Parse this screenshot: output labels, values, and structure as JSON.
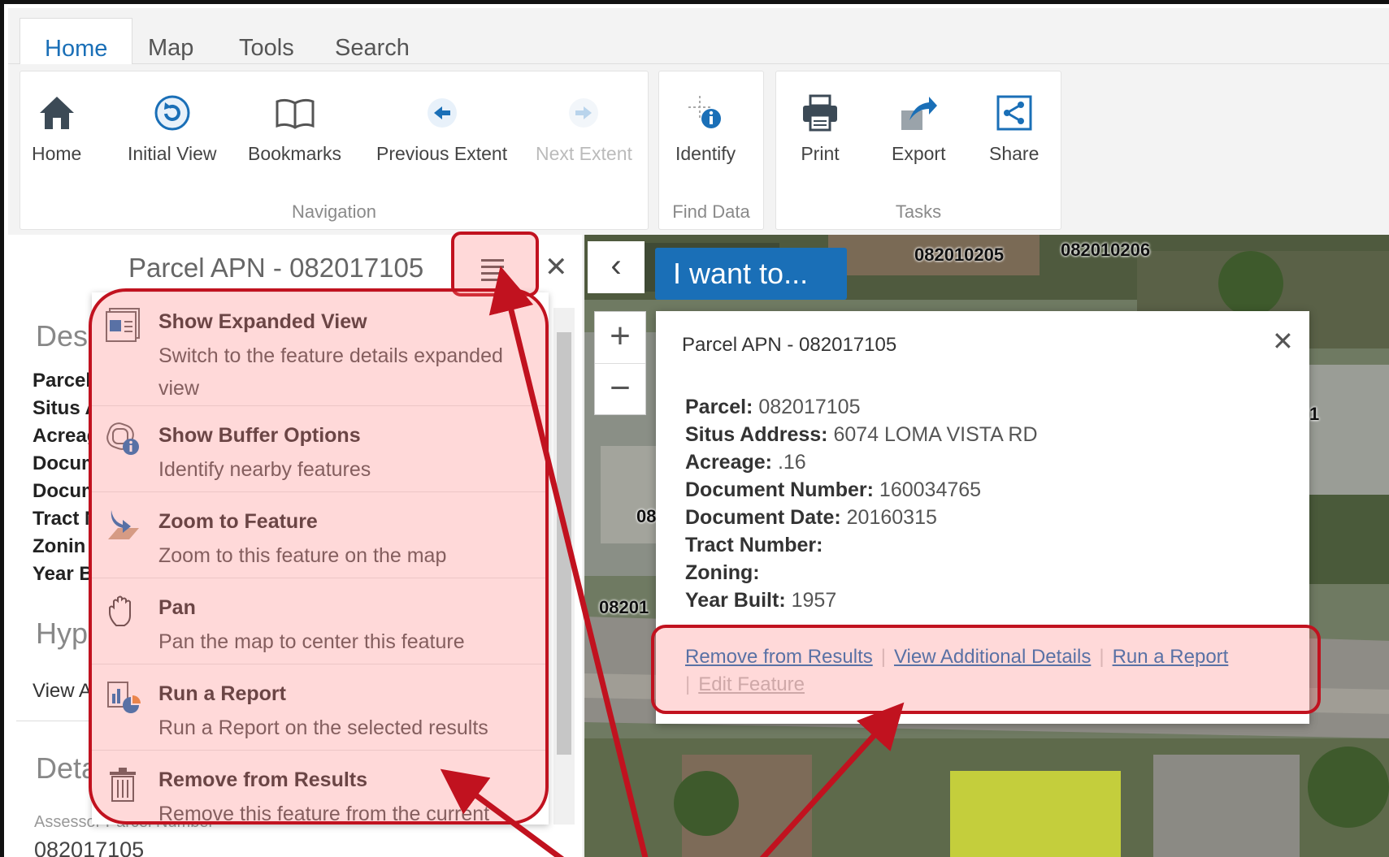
{
  "tabs": [
    "Home",
    "Map",
    "Tools",
    "Search"
  ],
  "navigation": {
    "group_label": "Navigation",
    "tools": [
      "Home",
      "Initial View",
      "Bookmarks",
      "Previous Extent",
      "Next Extent"
    ]
  },
  "find_data": {
    "group_label": "Find Data",
    "tools": [
      "Identify"
    ]
  },
  "tasks": {
    "group_label": "Tasks",
    "tools": [
      "Print",
      "Export",
      "Share"
    ]
  },
  "panel": {
    "title": "Parcel APN - 082017105",
    "section_desc": "Desc",
    "labels_partial": [
      "Parcel",
      "Situs A",
      "Acreag",
      "Docum",
      "Docum",
      "Tract N",
      "Zonin",
      "Year B"
    ],
    "section_hype": "Hype",
    "view_link": "View A",
    "section_deta": "Deta",
    "assessor_label": "Assessor Parcel Number",
    "assessor_value": "082017105"
  },
  "menu": [
    {
      "title": "Show Expanded View",
      "desc": "Switch to the feature details expanded view"
    },
    {
      "title": "Show Buffer Options",
      "desc": "Identify nearby features"
    },
    {
      "title": "Zoom to Feature",
      "desc": "Zoom to this feature on the map"
    },
    {
      "title": "Pan",
      "desc": "Pan the map to center this feature"
    },
    {
      "title": "Run a Report",
      "desc": "Run a Report on the selected results"
    },
    {
      "title": "Remove from Results",
      "desc": "Remove this feature from the current set"
    }
  ],
  "map": {
    "i_want_to": "I want to...",
    "parcel_labels": [
      "082010205",
      "082010206",
      "08",
      "08201",
      "1"
    ],
    "popup": {
      "title": "Parcel APN - 082017105",
      "fields": [
        {
          "label": "Parcel:",
          "value": "082017105"
        },
        {
          "label": "Situs Address:",
          "value": "6074 LOMA VISTA RD"
        },
        {
          "label": "Acreage:",
          "value": ".16"
        },
        {
          "label": "Document Number:",
          "value": "160034765"
        },
        {
          "label": "Document Date:",
          "value": "20160315"
        },
        {
          "label": "Tract Number:",
          "value": ""
        },
        {
          "label": "Zoning:",
          "value": ""
        },
        {
          "label": "Year Built:",
          "value": "1957"
        }
      ],
      "links": [
        "Remove from Results",
        "View Additional Details",
        "Run a Report"
      ],
      "disabled_link": "Edit Feature"
    }
  },
  "colors": {
    "accent": "#1a6fb7",
    "highlight_border": "#c1121f",
    "annotation_arrow": "#c1121f"
  }
}
